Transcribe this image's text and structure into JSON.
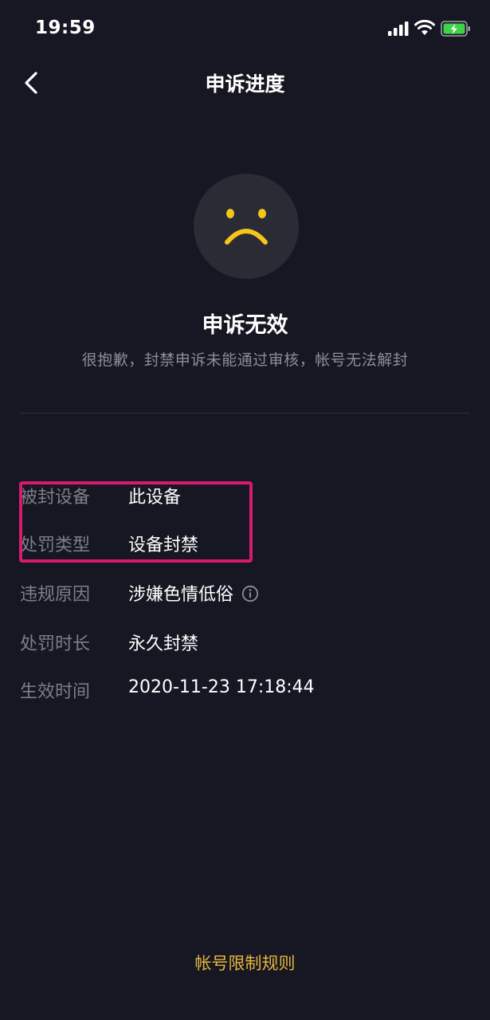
{
  "status_bar": {
    "time": "19:59",
    "icons": [
      "signal-icon",
      "wifi-icon",
      "battery-charging-icon"
    ]
  },
  "nav": {
    "title": "申诉进度",
    "back_icon": "chevron-left-icon"
  },
  "result": {
    "icon": "sad-face-icon",
    "title": "申诉无效",
    "description": "很抱歉，封禁申诉未能通过审核，帐号无法解封"
  },
  "details": [
    {
      "label": "被封设备",
      "value": "此设备"
    },
    {
      "label": "处罚类型",
      "value": "设备封禁"
    },
    {
      "label": "违规原因",
      "value": "涉嫌色情低俗",
      "icon": "info-icon"
    },
    {
      "label": "处罚时长",
      "value": "永久封禁"
    },
    {
      "label": "生效时间",
      "value": "2020-11-23 17:18:44"
    }
  ],
  "footer": {
    "rules_link": "帐号限制规则"
  },
  "colors": {
    "background": "#161722",
    "accent_link": "#e8b63f",
    "face": "#f5c518",
    "highlight": "#d81a6e"
  }
}
